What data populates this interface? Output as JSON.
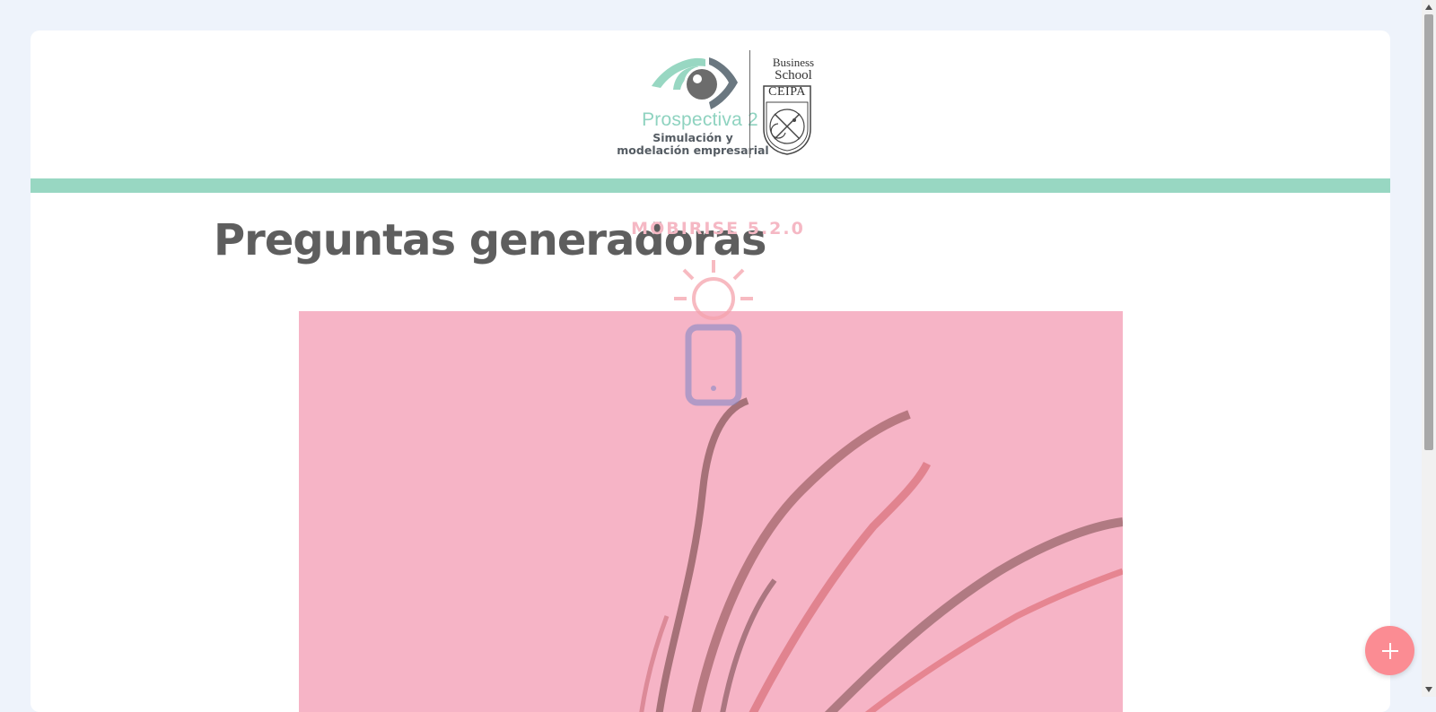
{
  "brand": {
    "title": "Prospectiva 2",
    "subtitle": "Simulación y\nmodelación empresarial",
    "school_line1": "Business",
    "school_line2": "School",
    "school_name": "CEIPA"
  },
  "page": {
    "heading": "Preguntas generadoras"
  },
  "loader": {
    "version_text": "MOBIRISE  5.2.0"
  },
  "fab": {
    "label": "+"
  },
  "colors": {
    "background": "#eef3fb",
    "accent_teal": "#98d7c2",
    "heading": "#5e5e5e",
    "image_pink": "#f6b4c6",
    "fab": "#fb8c93"
  }
}
